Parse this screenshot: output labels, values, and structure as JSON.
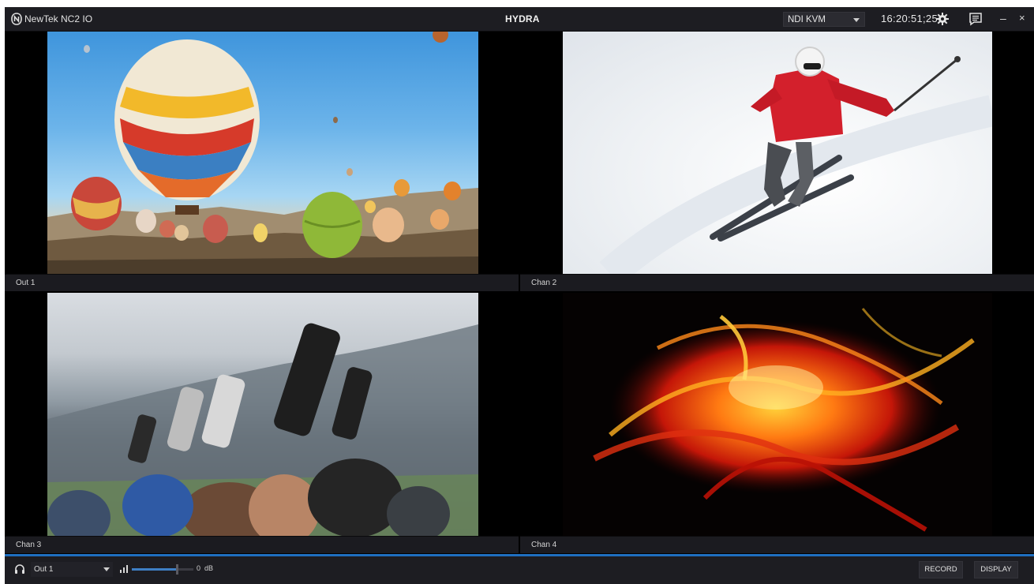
{
  "titlebar": {
    "app_name": "NewTek NC2 IO",
    "title": "HYDRA",
    "source_select": "NDI KVM",
    "timecode": "16:20:51;25"
  },
  "icons": {
    "logo": "newtek-logo-icon",
    "settings": "gear-icon",
    "notes": "notes-icon",
    "minimize": "minimize-icon",
    "close": "close-icon",
    "headphones": "headphones-icon",
    "meter": "signal-meter-icon"
  },
  "glyphs": {
    "minimize": "–",
    "close": "×"
  },
  "monitors": [
    {
      "label": "Out 1"
    },
    {
      "label": "Chan 2"
    },
    {
      "label": "Chan 3"
    },
    {
      "label": "Chan 4"
    }
  ],
  "bottombar": {
    "monitor_select": "Out 1",
    "volume_value": "0",
    "volume_unit": "dB",
    "volume_level_fraction": 0.72,
    "record_label": "RECORD",
    "display_label": "DISPLAY"
  },
  "colors": {
    "accent": "#1f6fc0",
    "panel": "#1d1d22",
    "background": "#000000"
  }
}
